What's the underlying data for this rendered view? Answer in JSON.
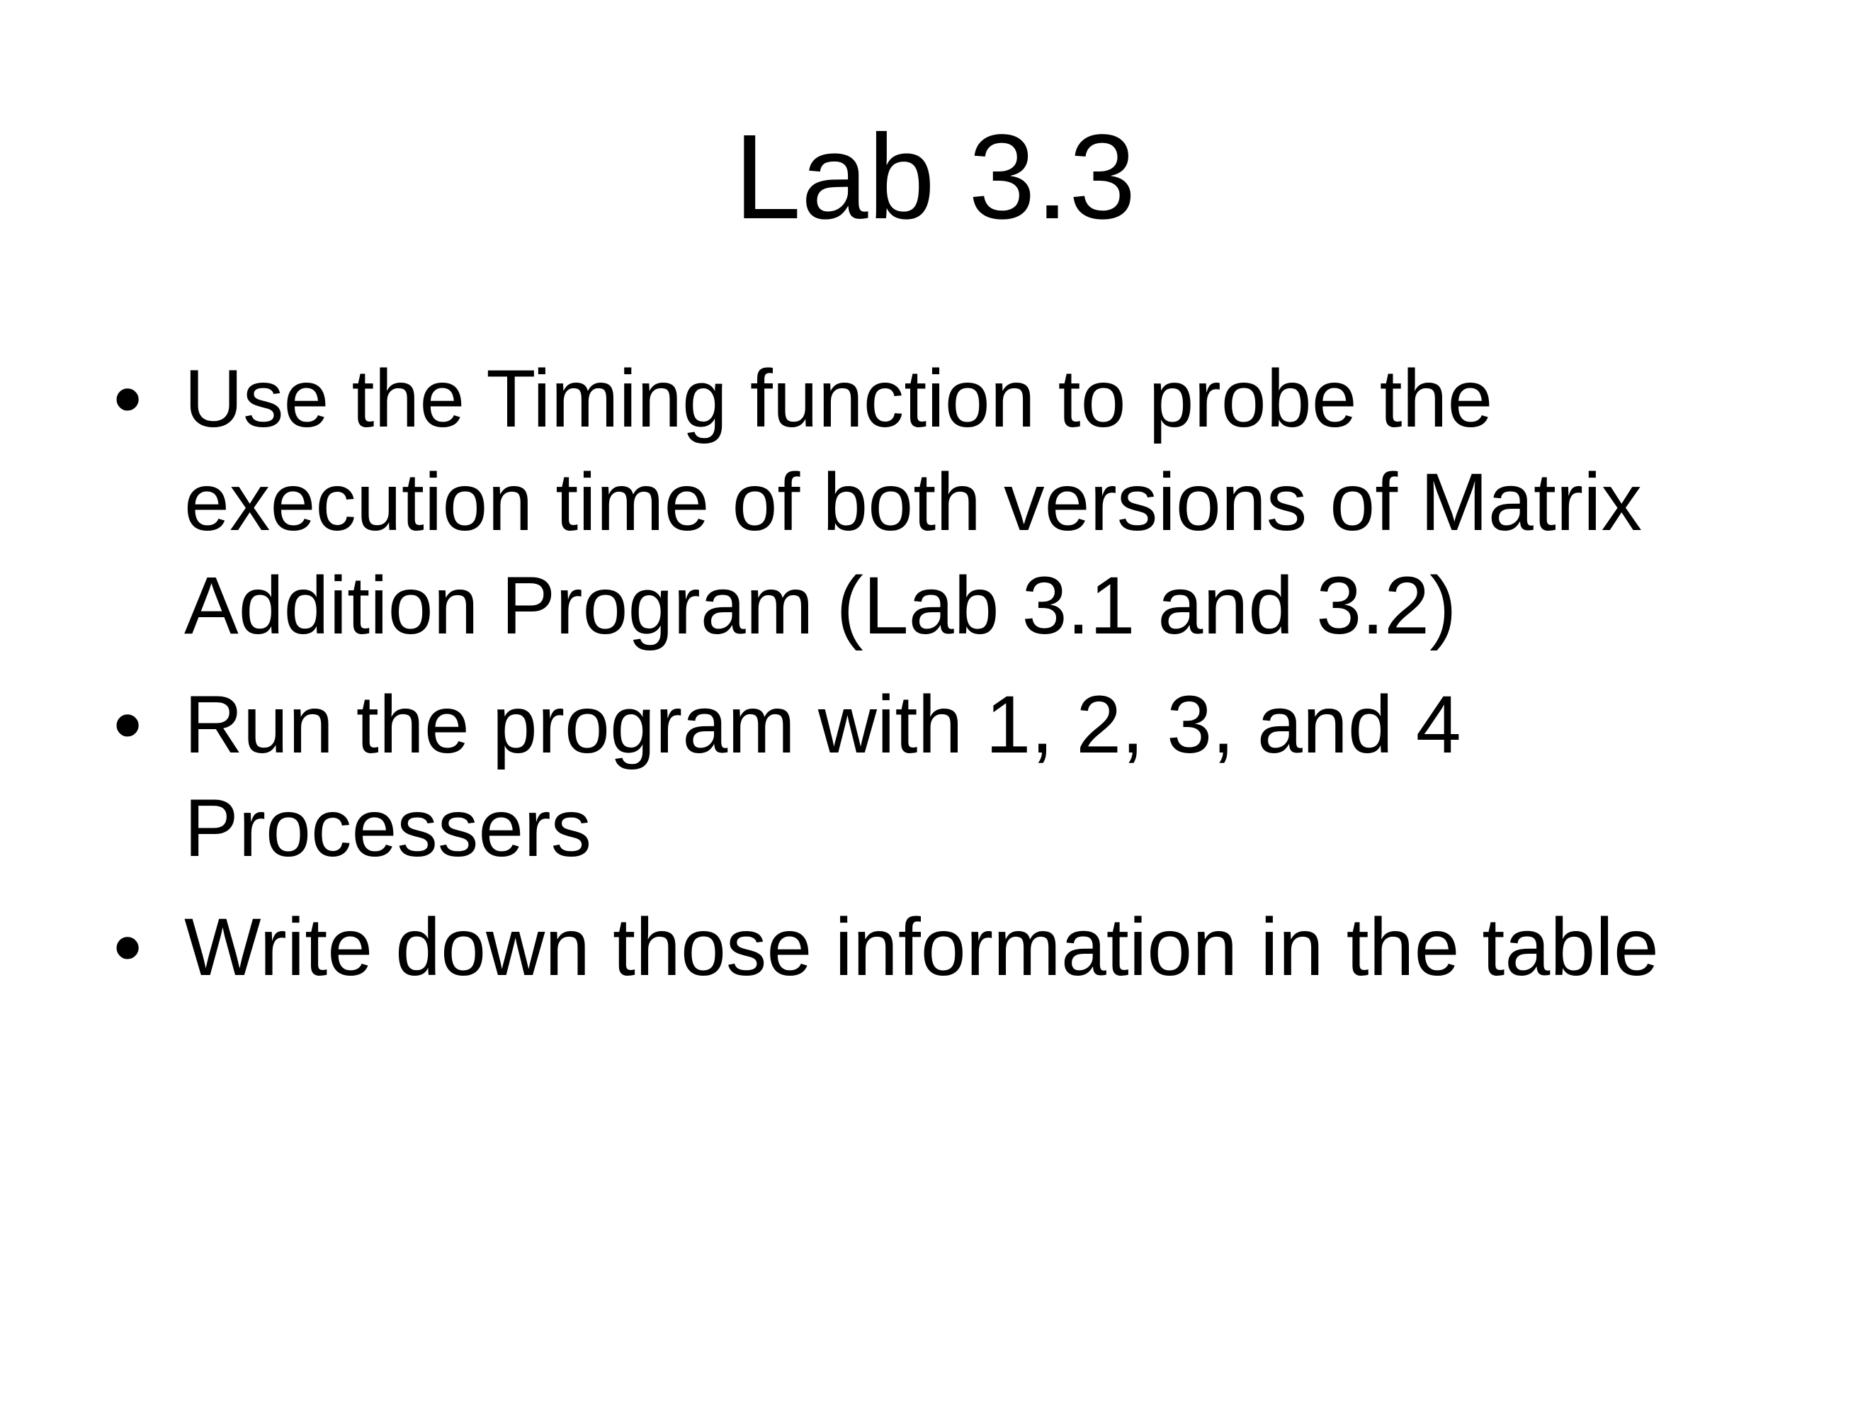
{
  "slide": {
    "title": "Lab 3.3",
    "bullet_symbol": "•",
    "bullets": [
      {
        "text": "Use the Timing function to probe the execution time of both versions of Matrix Addition Program (Lab 3.1 and 3.2)"
      },
      {
        "text": "Run the program with 1, 2, 3, and 4 Processers"
      },
      {
        "text": "Write down those information in the table"
      }
    ]
  },
  "colors": {
    "background": "#ffffff",
    "text": "#000000"
  }
}
